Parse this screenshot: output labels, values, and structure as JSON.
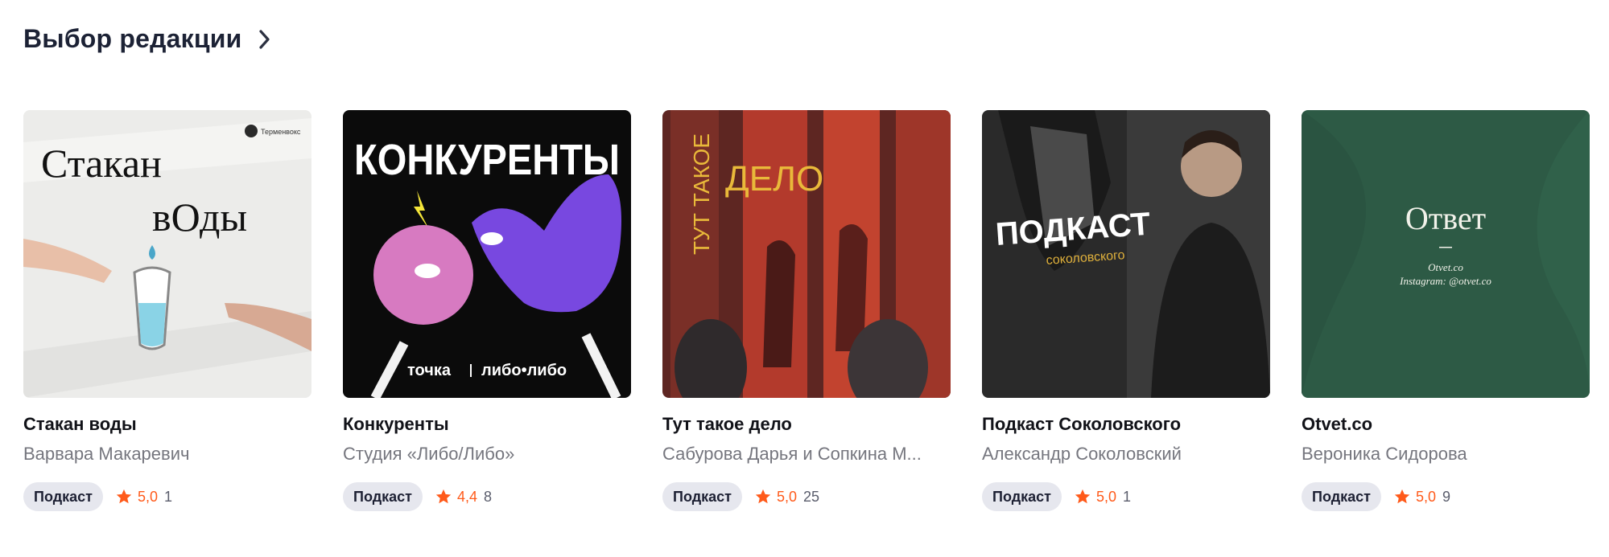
{
  "section": {
    "title": "Выбор редакции",
    "chevron_icon": "chevron-right-icon"
  },
  "colors": {
    "accent_star": "#ff5a1a",
    "badge_bg": "#e6e7ee"
  },
  "cards": [
    {
      "title": "Стакан воды",
      "author": "Варвара Макаревич",
      "badge": "Подкаст",
      "rating": "5,0",
      "count": "1",
      "cover": {
        "line1": "Стакан",
        "line2": "вОды",
        "logo": "Терменвокс"
      }
    },
    {
      "title": "Конкуренты",
      "author": "Студия «Либо/Либо»",
      "badge": "Подкаст",
      "rating": "4,4",
      "count": "8",
      "cover": {
        "headline": "КОНКУРЕНТЫ",
        "brand_left": "точка",
        "brand_right": "либо•либо"
      }
    },
    {
      "title": "Тут такое дело",
      "author": "Сабурова Дарья и Сопкина М...",
      "badge": "Подкаст",
      "rating": "5,0",
      "count": "25",
      "cover": {
        "vertical_a": "ТУТ ТАКОЕ",
        "vertical_b": "ДЕЛО"
      }
    },
    {
      "title": "Подкаст Соколовского",
      "author": "Александр Соколовский",
      "badge": "Подкаст",
      "rating": "5,0",
      "count": "1",
      "cover": {
        "headline": "ПОДКАСТ",
        "sub": "соколовского"
      }
    },
    {
      "title": "Otvet.co",
      "author": "Вероника Сидорова",
      "badge": "Подкаст",
      "rating": "5,0",
      "count": "9",
      "cover": {
        "logo": "Ответ",
        "line1": "Otvet.co",
        "line2": "Instagram: @otvet.co"
      }
    }
  ]
}
